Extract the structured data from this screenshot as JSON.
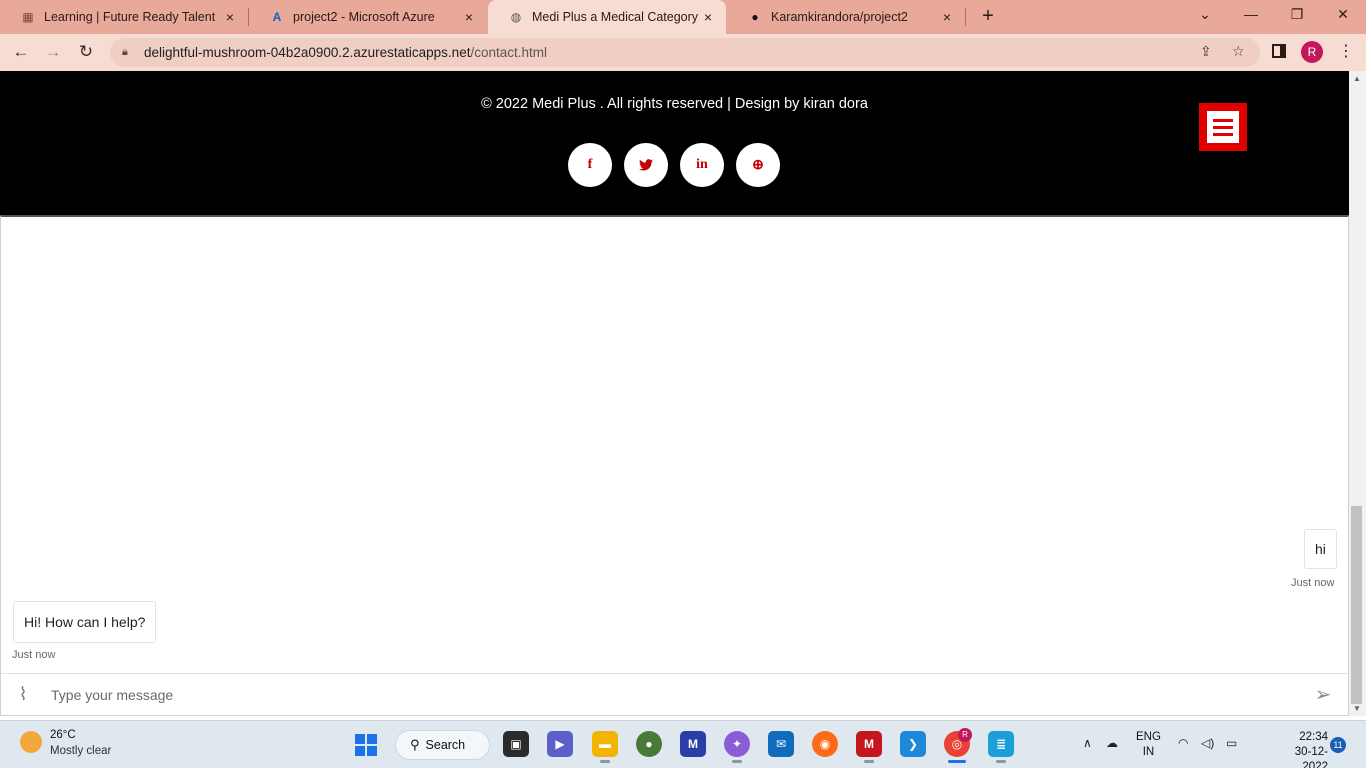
{
  "browser": {
    "tabs": [
      {
        "title": "Learning | Future Ready Talent",
        "icon": "learning-icon"
      },
      {
        "title": "project2 - Microsoft Azure",
        "icon": "azure-icon"
      },
      {
        "title": "Medi Plus a Medical Category Fla",
        "icon": "globe-icon"
      },
      {
        "title": "Karamkirandora/project2",
        "icon": "github-icon"
      }
    ],
    "close_glyph": "×",
    "new_tab_glyph": "+",
    "url_host": "delightful-mushroom-04b2a0900.2.azurestaticapps.net",
    "url_path": "/contact.html",
    "profile_initial": "R"
  },
  "page": {
    "copyright": "© 2022 Medi Plus . All rights reserved | Design by kiran dora",
    "socials": [
      {
        "name": "facebook",
        "glyph": "f"
      },
      {
        "name": "twitter",
        "glyph": "t"
      },
      {
        "name": "linkedin",
        "glyph": "in"
      },
      {
        "name": "dribbble",
        "glyph": "⊕"
      }
    ]
  },
  "chat": {
    "user_message": "hi",
    "user_time": "Just now",
    "bot_message": "Hi! How can I help?",
    "bot_time": "Just now",
    "input_placeholder": "Type your message"
  },
  "taskbar": {
    "weather_temp": "26°C",
    "weather_desc": "Mostly clear",
    "search_label": "Search",
    "lang_top": "ENG",
    "lang_bottom": "IN",
    "time": "22:34",
    "date": "30-12-2022",
    "notification_count": "11",
    "chrome_badge": "R"
  },
  "colors": {
    "brand_red": "#e00000",
    "tabstrip": "#e8a99a",
    "toolbar": "#f6dcd2"
  }
}
